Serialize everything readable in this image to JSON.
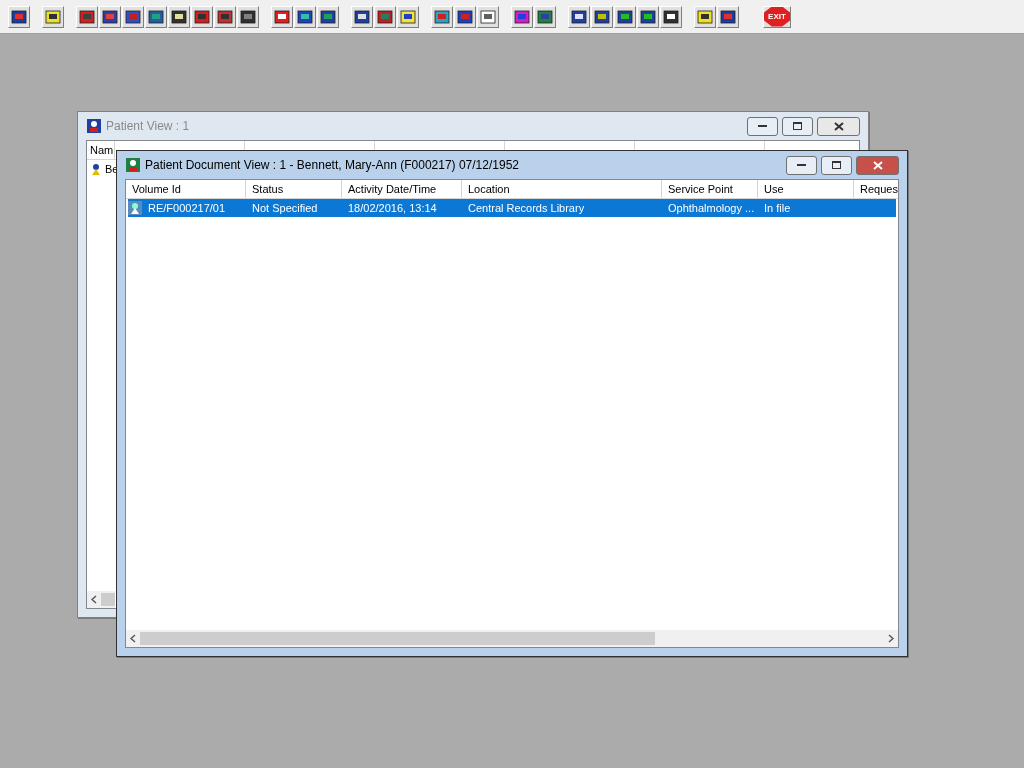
{
  "toolbar": {
    "exit_label": "EXIT"
  },
  "windows": [
    {
      "title": "Patient View : 1",
      "active": false,
      "columns": [
        "Nam"
      ],
      "rows": [
        [
          "Be"
        ]
      ]
    },
    {
      "title": "Patient Document View : 1 - Bennett, Mary-Ann (F000217) 07/12/1952",
      "active": true,
      "columns": [
        "Volume Id",
        "Status",
        "Activity Date/Time",
        "Location",
        "Service Point",
        "Use",
        "Reques"
      ],
      "rows": [
        {
          "cells": [
            "RE/F000217/01",
            "Not Specified",
            "18/02/2016, 13:14",
            "Central Records Library",
            "Ophthalmology ...",
            "In file"
          ],
          "selected": true
        }
      ]
    }
  ]
}
